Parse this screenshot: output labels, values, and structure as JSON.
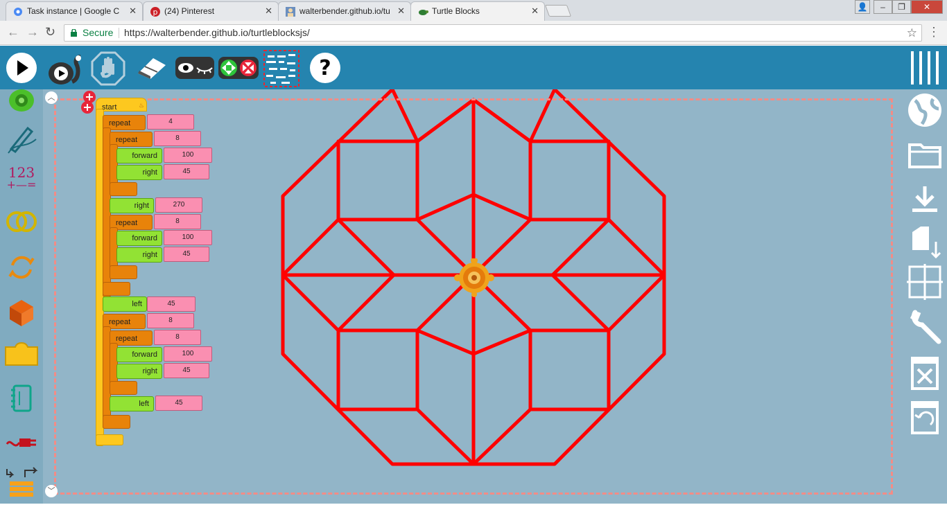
{
  "browser": {
    "tabs": [
      {
        "title": "Task instance | Google C",
        "icon": "gear-icon"
      },
      {
        "title": "(24) Pinterest",
        "icon": "pinterest-icon"
      },
      {
        "title": "walterbender.github.io/tu",
        "icon": "avatar-icon"
      },
      {
        "title": "Turtle Blocks",
        "icon": "turtle-icon"
      }
    ],
    "secure_label": "Secure",
    "url": "https://walterbender.github.io/turtleblocksjs/",
    "colors": {
      "tabbar": "#d9dde2",
      "secure": "#0b8043"
    }
  },
  "toolbar": {
    "buttons": [
      "play-icon",
      "slow-play-icon",
      "stop-icon",
      "eraser-icon",
      "hide-show-blocks-icon",
      "collapse-expand-icon",
      "grid-menu-icon",
      "help-icon",
      "main-menu-icon"
    ],
    "color": "#2584af"
  },
  "palette": {
    "items": [
      "turtle-palette-icon",
      "pen-palette-icon",
      "number-palette-icon",
      "boolean-palette-icon",
      "flow-palette-icon",
      "boxes-palette-icon",
      "action-palette-icon",
      "media-palette-icon",
      "sensors-palette-icon",
      "extras-palette-icon"
    ],
    "number_glyph": "123"
  },
  "right_toolbar": {
    "items": [
      "planet-icon",
      "open-file-icon",
      "save-icon",
      "load-samples-icon",
      "grid-icon",
      "settings-icon",
      "empty-trash-icon",
      "restore-trash-icon"
    ]
  },
  "program": {
    "start_label": "start",
    "blocks": {
      "repeat1": {
        "label": "repeat",
        "value": "4"
      },
      "repeat2": {
        "label": "repeat",
        "value": "8"
      },
      "forward1": {
        "label": "forward",
        "value": "100"
      },
      "right1": {
        "label": "right",
        "value": "45"
      },
      "right2": {
        "label": "right",
        "value": "270"
      },
      "repeat3": {
        "label": "repeat",
        "value": "8"
      },
      "forward2": {
        "label": "forward",
        "value": "100"
      },
      "right3": {
        "label": "right",
        "value": "45"
      },
      "left1": {
        "label": "left",
        "value": "45"
      },
      "repeat4": {
        "label": "repeat",
        "value": "8"
      },
      "repeat5": {
        "label": "repeat",
        "value": "8"
      },
      "forward3": {
        "label": "forward",
        "value": "100"
      },
      "right4": {
        "label": "right",
        "value": "45"
      },
      "left2": {
        "label": "left",
        "value": "45"
      }
    }
  },
  "drawing": {
    "pen_color": "#ff0000",
    "background": "#92b5c8"
  }
}
